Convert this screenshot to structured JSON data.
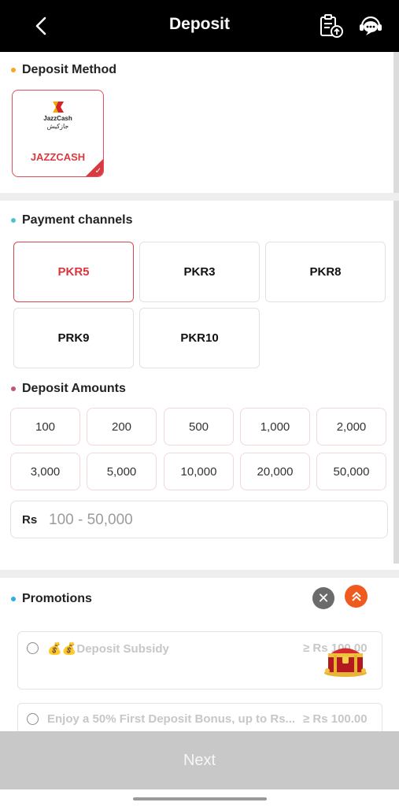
{
  "header": {
    "title": "Deposit",
    "back_icon": "chevron-left-icon",
    "records_icon": "clipboard-upload-icon",
    "support_icon": "chat-support-icon"
  },
  "deposit_method": {
    "title": "Deposit Method",
    "dot_color": "#f5a623",
    "selected": {
      "logo_text": "JazzCash",
      "logo_subtext": "جازکیش",
      "label": "JAZZCASH"
    }
  },
  "payment_channels": {
    "title": "Payment channels",
    "dot_color": "#4fc3c8",
    "items": [
      "PKR5",
      "PKR3",
      "PKR8",
      "PRK9",
      "PKR10"
    ],
    "selected": "PKR5"
  },
  "deposit_amounts": {
    "title": "Deposit Amounts",
    "dot_color": "#c0567a",
    "items": [
      "100",
      "200",
      "500",
      "1,000",
      "2,000",
      "3,000",
      "5,000",
      "10,000",
      "20,000",
      "50,000"
    ],
    "currency": "Rs",
    "placeholder": "100 - 50,000"
  },
  "promotions": {
    "title": "Promotions",
    "dot_color": "#2ab0e0",
    "items": [
      {
        "emoji": "💰💰",
        "label": "Deposit Subsidy",
        "amount": "≥ Rs 100.00"
      },
      {
        "emoji": "",
        "label": "Enjoy a 50% First Deposit Bonus, up to Rs...",
        "amount": "≥ Rs 100.00"
      }
    ]
  },
  "next_button": {
    "label": "Next"
  },
  "colors": {
    "accent": "#d8363c",
    "header_bg": "#000000",
    "disabled_bg": "#c8c8c8",
    "scroll_top_btn": "#ef5a1f"
  }
}
